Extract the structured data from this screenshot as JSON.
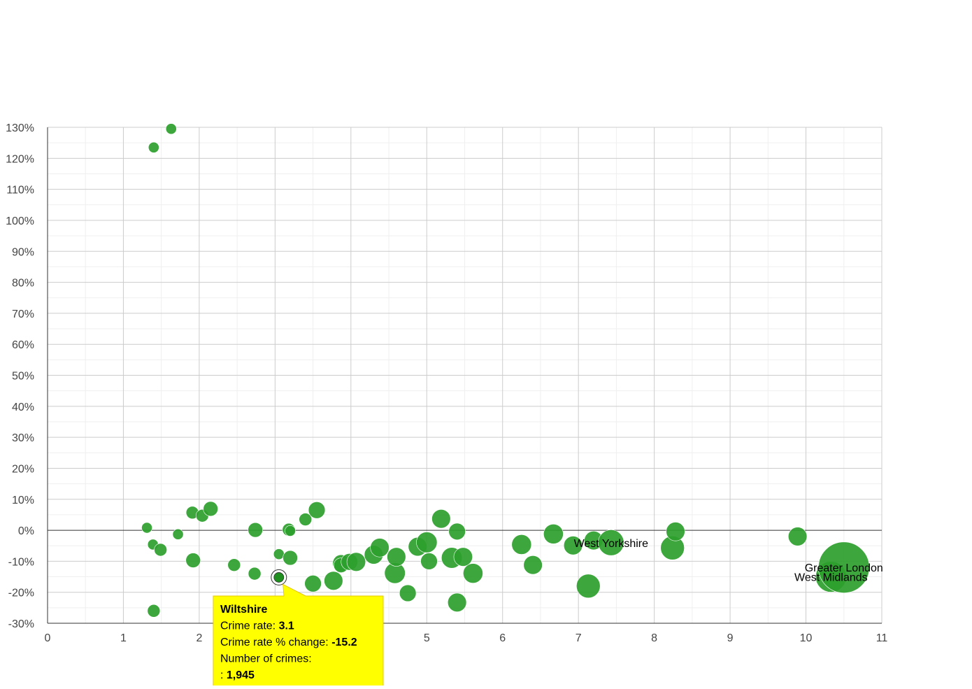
{
  "chart_data": {
    "type": "scatter",
    "x_axis": {
      "min": 0,
      "max": 11,
      "ticks": [
        0,
        1,
        2,
        3,
        4,
        5,
        6,
        7,
        8,
        9,
        10,
        11
      ],
      "tick_labels": [
        "0",
        "1",
        "2",
        "",
        "",
        "5",
        "6",
        "7",
        "8",
        "9",
        "10",
        "11"
      ]
    },
    "y_axis": {
      "min": -30,
      "max": 130,
      "ticks": [
        -30,
        -20,
        -10,
        0,
        10,
        20,
        30,
        40,
        50,
        60,
        70,
        80,
        90,
        100,
        110,
        120,
        130
      ],
      "tick_labels": [
        "-30%",
        "-20%",
        "-10%",
        "0%",
        "10%",
        "20%",
        "30%",
        "40%",
        "50%",
        "60%",
        "70%",
        "80%",
        "90%",
        "100%",
        "110%",
        "120%",
        "130%"
      ]
    },
    "grid": true,
    "point_color": "#2ca02c",
    "highlight_color": "#1f8f1f",
    "points": [
      {
        "x": 1.63,
        "y": 129.5,
        "size": 1
      },
      {
        "x": 1.4,
        "y": 123.5,
        "size": 1
      },
      {
        "x": 1.31,
        "y": 0.8,
        "size": 1
      },
      {
        "x": 1.39,
        "y": -4.6,
        "size": 1
      },
      {
        "x": 1.49,
        "y": -6.3,
        "size": 1.4
      },
      {
        "x": 1.72,
        "y": -1.3,
        "size": 1
      },
      {
        "x": 1.91,
        "y": 5.7,
        "size": 1.4
      },
      {
        "x": 2.04,
        "y": 4.7,
        "size": 1.4
      },
      {
        "x": 2.15,
        "y": 6.9,
        "size": 1.8
      },
      {
        "x": 1.92,
        "y": -9.7,
        "size": 1.8
      },
      {
        "x": 1.4,
        "y": -26.0,
        "size": 1.4
      },
      {
        "x": 2.46,
        "y": -11.2,
        "size": 1.4
      },
      {
        "x": 2.74,
        "y": 0.1,
        "size": 1.8
      },
      {
        "x": 2.73,
        "y": -14.0,
        "size": 1.4
      },
      {
        "x": 3.05,
        "y": -7.7,
        "size": 1
      },
      {
        "x": 3.18,
        "y": 0.2,
        "size": 1.4
      },
      {
        "x": 3.2,
        "y": -0.2,
        "size": 1
      },
      {
        "x": 3.2,
        "y": -8.9,
        "size": 1.8
      },
      {
        "x": 3.4,
        "y": 3.5,
        "size": 1.4
      },
      {
        "x": 3.55,
        "y": 6.5,
        "size": 2.2
      },
      {
        "x": 3.5,
        "y": -17.2,
        "size": 2.2
      },
      {
        "x": 3.77,
        "y": -16.3,
        "size": 2.6
      },
      {
        "x": 3.87,
        "y": -10.6,
        "size": 2.2
      },
      {
        "x": 3.87,
        "y": -11.3,
        "size": 1.8
      },
      {
        "x": 3.98,
        "y": -10.2,
        "size": 2.2
      },
      {
        "x": 4.07,
        "y": -10.2,
        "size": 2.6
      },
      {
        "x": 4.3,
        "y": -7.9,
        "size": 2.6
      },
      {
        "x": 4.38,
        "y": -5.6,
        "size": 2.6
      },
      {
        "x": 4.58,
        "y": -13.8,
        "size": 3.0
      },
      {
        "x": 4.6,
        "y": -8.6,
        "size": 2.6
      },
      {
        "x": 4.75,
        "y": -20.3,
        "size": 2.2
      },
      {
        "x": 4.88,
        "y": -5.3,
        "size": 2.6
      },
      {
        "x": 5.0,
        "y": -3.9,
        "size": 3.0
      },
      {
        "x": 5.03,
        "y": -10.0,
        "size": 2.2
      },
      {
        "x": 5.19,
        "y": 3.7,
        "size": 2.6
      },
      {
        "x": 5.33,
        "y": -8.9,
        "size": 3.0
      },
      {
        "x": 5.4,
        "y": -0.4,
        "size": 2.2
      },
      {
        "x": 5.4,
        "y": -23.3,
        "size": 2.6
      },
      {
        "x": 5.48,
        "y": -8.6,
        "size": 2.6
      },
      {
        "x": 5.61,
        "y": -13.9,
        "size": 2.8
      },
      {
        "x": 6.25,
        "y": -4.6,
        "size": 2.8
      },
      {
        "x": 6.4,
        "y": -11.2,
        "size": 2.6
      },
      {
        "x": 6.67,
        "y": -1.2,
        "size": 2.8
      },
      {
        "x": 6.93,
        "y": -4.9,
        "size": 2.6
      },
      {
        "x": 7.13,
        "y": -18.0,
        "size": 3.6
      },
      {
        "x": 7.2,
        "y": -3.3,
        "size": 2.6
      },
      {
        "x": 7.43,
        "y": -4.0,
        "size": 4.0,
        "label": "West Yorkshire"
      },
      {
        "x": 8.24,
        "y": -5.7,
        "size": 3.6
      },
      {
        "x": 8.28,
        "y": -0.4,
        "size": 2.6
      },
      {
        "x": 9.89,
        "y": -2.0,
        "size": 2.6
      },
      {
        "x": 10.33,
        "y": -15.0,
        "size": 5.0,
        "label": "West Midlands"
      },
      {
        "x": 10.5,
        "y": -12.0,
        "size": 9.0,
        "label": "Greater London"
      }
    ],
    "highlight": {
      "x": 3.05,
      "y": -15.2
    }
  },
  "tooltip": {
    "title": "Wiltshire",
    "rate_label": "Crime rate: ",
    "rate_value": "3.1",
    "change_label": "Crime rate % change: ",
    "change_value": "-15.2",
    "count_label": "Number of crimes:",
    "count_prefix": ": ",
    "count_value": "1,945",
    "background": "#ffff00",
    "border": "#e6c800"
  }
}
